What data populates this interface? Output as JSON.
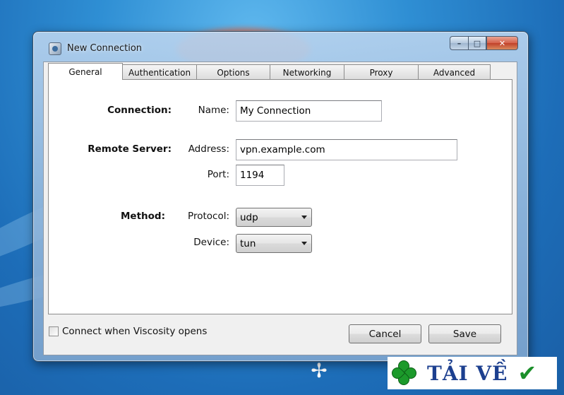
{
  "window": {
    "title": "New Connection",
    "controls": {
      "minimize": "–",
      "maximize": "□",
      "close": "✕"
    }
  },
  "tabs": [
    {
      "label": "General",
      "active": true
    },
    {
      "label": "Authentication",
      "active": false
    },
    {
      "label": "Options",
      "active": false
    },
    {
      "label": "Networking",
      "active": false
    },
    {
      "label": "Proxy",
      "active": false
    },
    {
      "label": "Advanced",
      "active": false
    }
  ],
  "general": {
    "connection": {
      "section_label": "Connection:",
      "name_label": "Name:",
      "name_value": "My Connection"
    },
    "remote_server": {
      "section_label": "Remote Server:",
      "address_label": "Address:",
      "address_value": "vpn.example.com",
      "port_label": "Port:",
      "port_value": "1194"
    },
    "method": {
      "section_label": "Method:",
      "protocol_label": "Protocol:",
      "protocol_value": "udp",
      "device_label": "Device:",
      "device_value": "tun"
    }
  },
  "footer": {
    "checkbox_label": "Connect when Viscosity opens",
    "checkbox_checked": false,
    "cancel_label": "Cancel",
    "save_label": "Save"
  },
  "watermark": {
    "text": "TẢI VỀ",
    "icon": "clover-icon",
    "check_icon": "checkmark-icon"
  },
  "colors": {
    "desktop_bg": "#2f8fd4",
    "watermark_text": "#1c3f8f",
    "watermark_green": "#1c9a2b"
  }
}
